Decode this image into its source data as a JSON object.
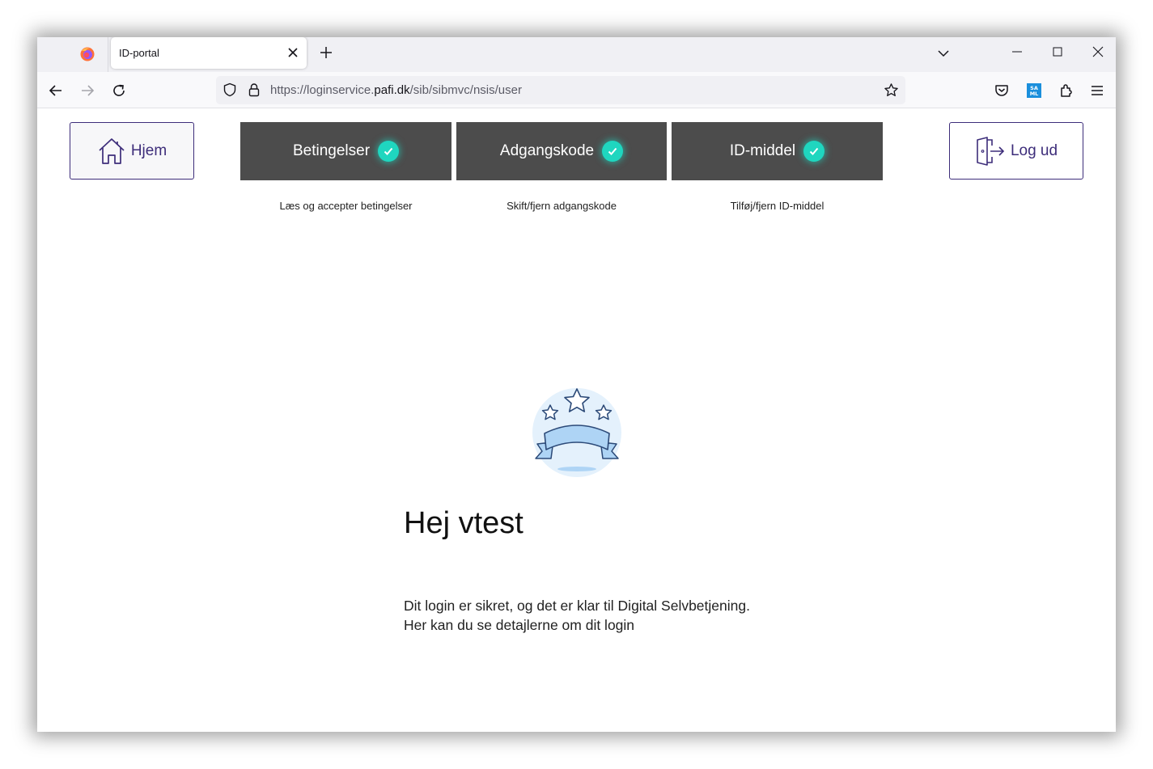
{
  "browser": {
    "tab_title": "ID-portal",
    "url_scheme_prefix": "https://loginservice.",
    "url_domain": "pafi.dk",
    "url_path": "/sib/sibmvc/nsis/user",
    "icons": {
      "logo": "firefox-icon",
      "tab_close": "close-icon",
      "new_tab": "plus-icon",
      "back": "arrow-left-icon",
      "forward": "arrow-right-icon",
      "reload": "reload-icon",
      "shield": "shield-icon",
      "lock": "lock-icon",
      "bookmark": "star-icon",
      "pocket": "pocket-icon",
      "saml_ext": "saml-extension-icon",
      "extensions": "puzzle-icon",
      "menu": "hamburger-icon"
    },
    "saml_label": "SA ML"
  },
  "page": {
    "home_label": "Hjem",
    "logout_label": "Log ud",
    "steps": [
      {
        "label": "Betingelser",
        "description": "Læs og accepter betingelser"
      },
      {
        "label": "Adgangskode",
        "description": "Skift/fjern adgangskode"
      },
      {
        "label": "ID-middel",
        "description": "Tilføj/fjern ID-middel"
      }
    ],
    "greeting": "Hej vtest",
    "message_line1": "Dit login er sikret, og det er klar til Digital Selvbetjening.",
    "message_line2": "Her kan du se detajlerne om dit login"
  },
  "colors": {
    "accent": "#3d2d7a",
    "step_bg": "#4c4c4c",
    "check": "#1fd6bf"
  }
}
